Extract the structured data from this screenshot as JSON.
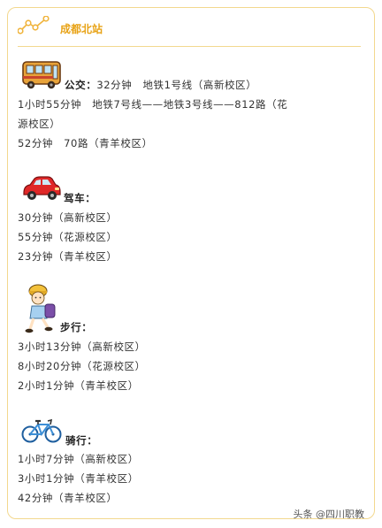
{
  "header": {
    "title": "成都北站",
    "icon": "dots-line-icon",
    "accent": "#e8a317",
    "border": "#f3d88e"
  },
  "sections": {
    "bus": {
      "icon": "bus-icon",
      "label": "公交：",
      "first": "32分钟　地铁1号线（高新校区）",
      "lines": [
        "1小时55分钟　地铁7号线——地铁3号线——812路（花",
        "源校区）",
        "52分钟　70路（青羊校区）"
      ]
    },
    "car": {
      "icon": "car-icon",
      "label": "驾车：",
      "lines": [
        "30分钟（高新校区）",
        "55分钟（花源校区）",
        "23分钟（青羊校区）"
      ]
    },
    "walk": {
      "icon": "walking-child-icon",
      "label": "步行：",
      "lines": [
        "3小时13分钟（高新校区）",
        "8小时20分钟（花源校区）",
        "2小时1分钟（青羊校区）"
      ]
    },
    "bike": {
      "icon": "bicycle-icon",
      "label": "骑行：",
      "lines": [
        "1小时7分钟（高新校区）",
        "3小时1分钟（青羊校区）",
        "42分钟（青羊校区）"
      ]
    }
  },
  "watermark": "头条 @四川职教"
}
